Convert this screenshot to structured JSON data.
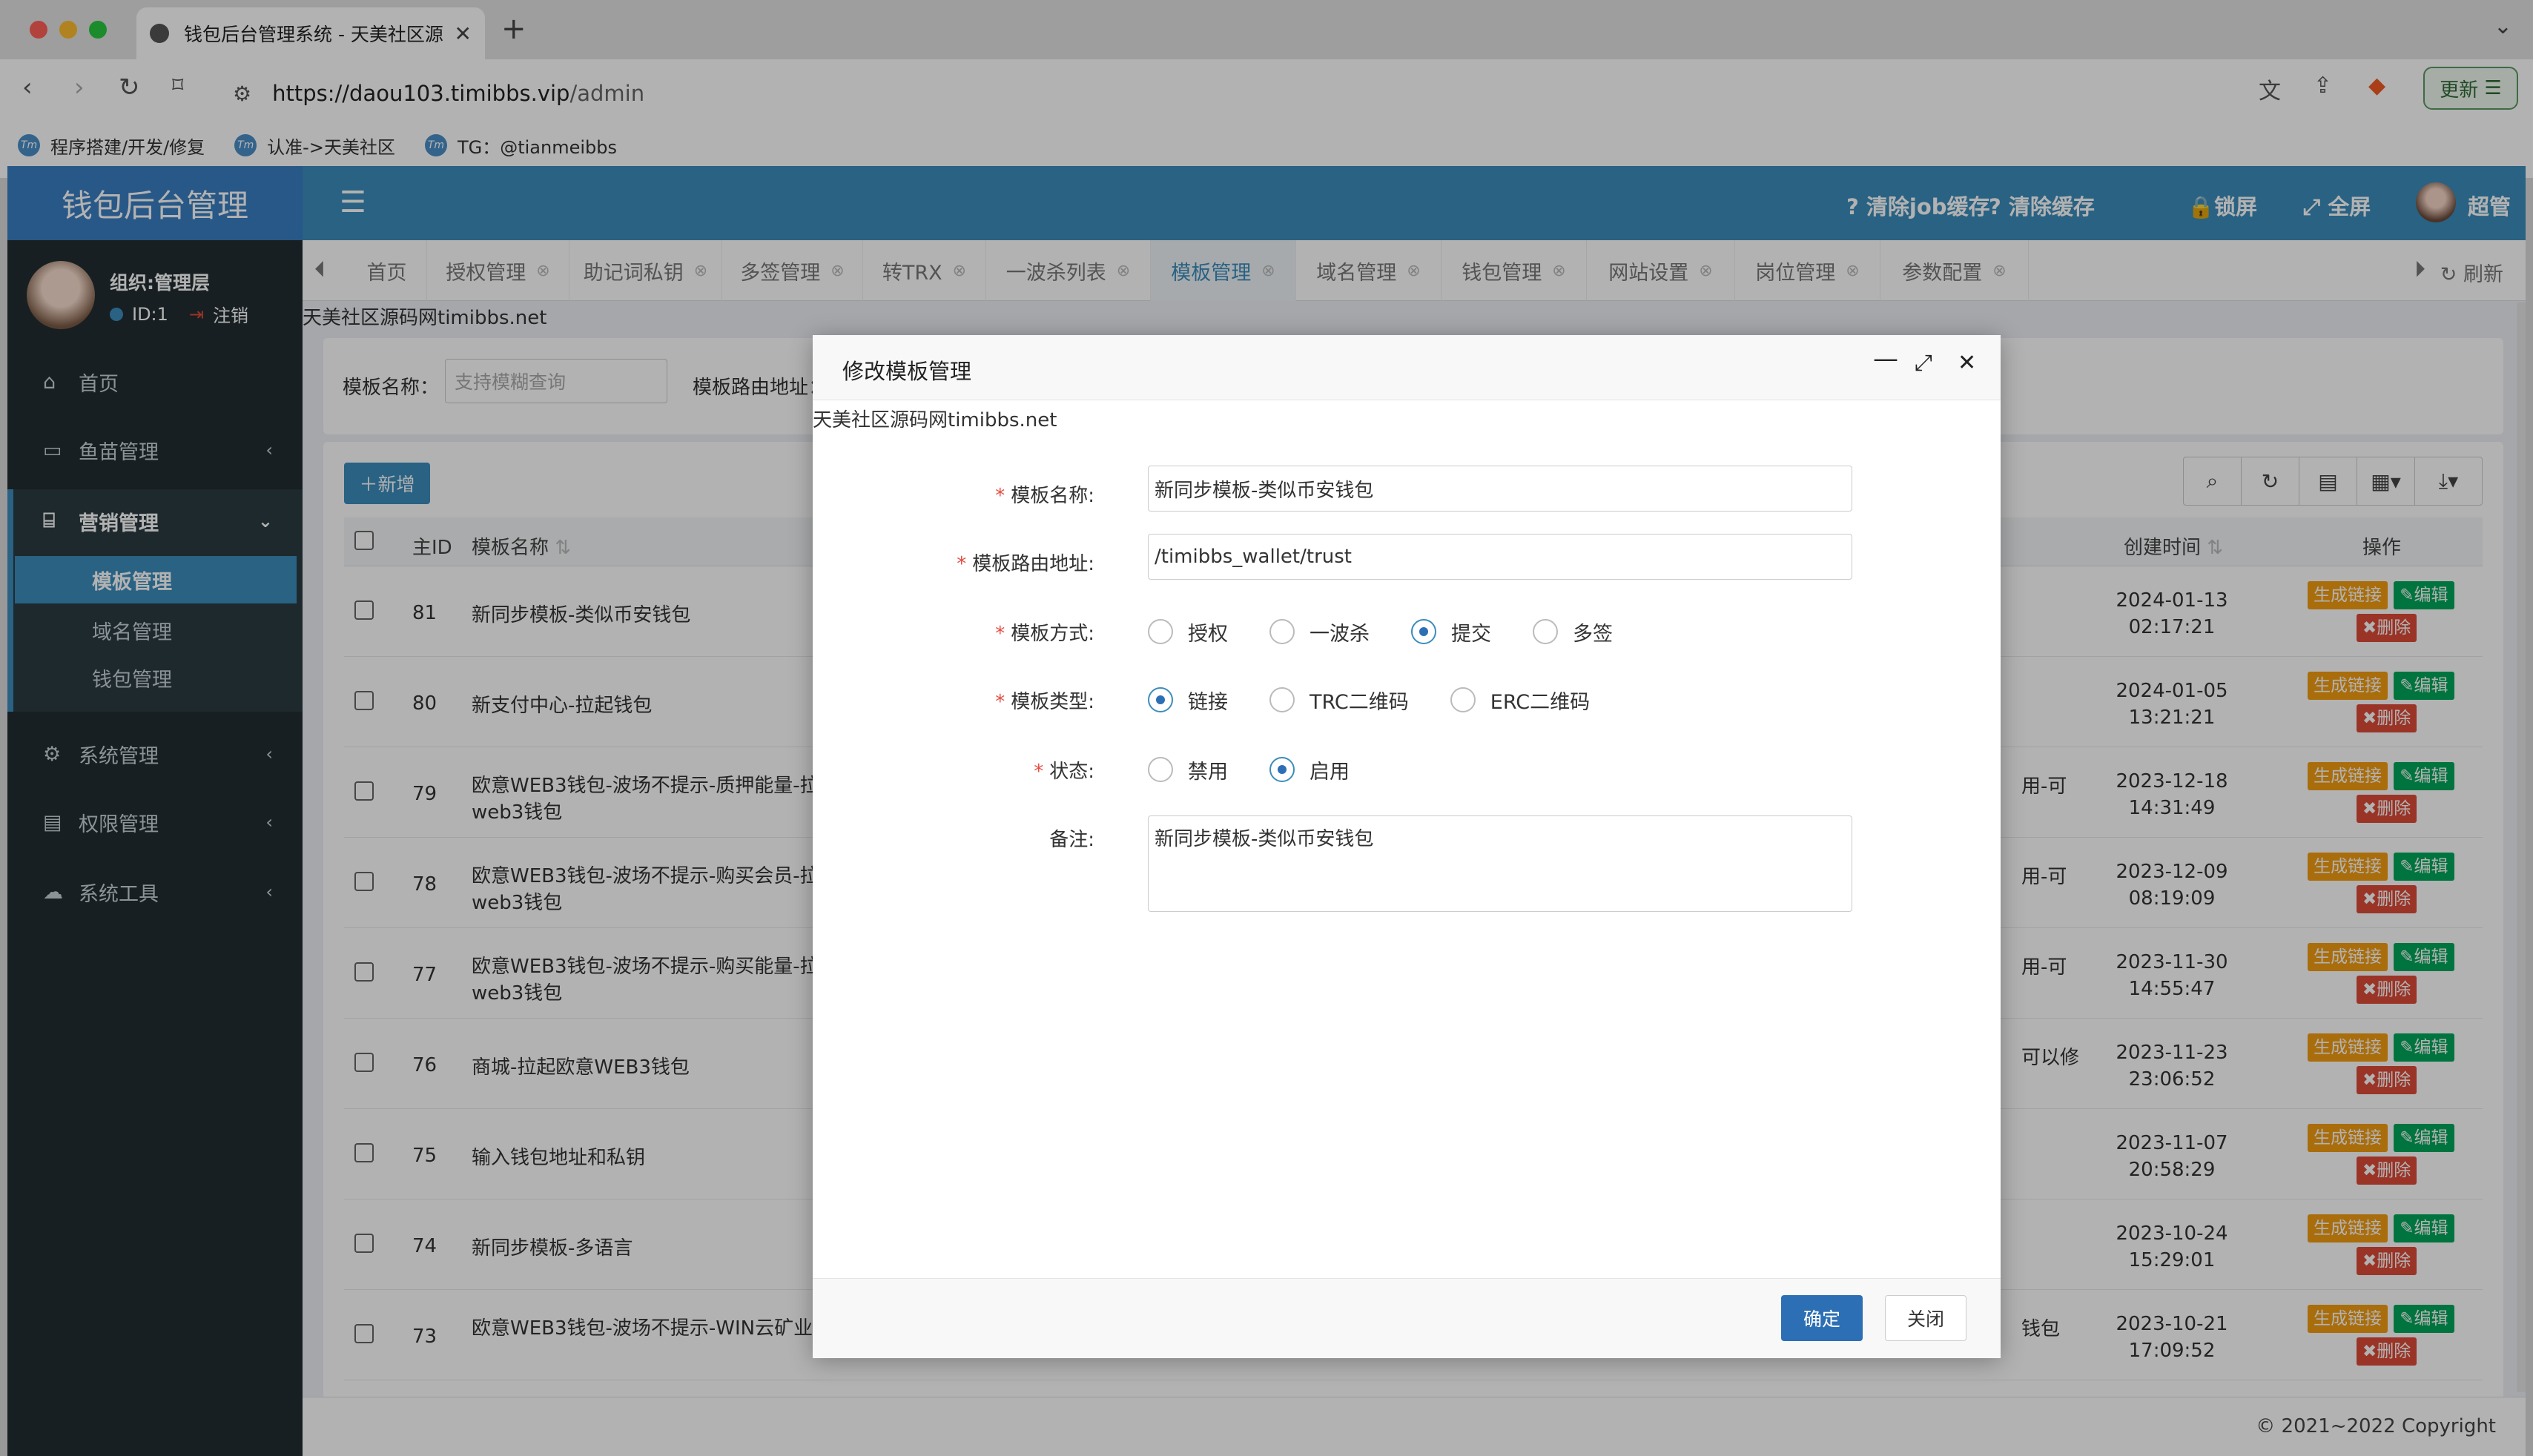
{
  "browser": {
    "tab_title": "钱包后台管理系统 - 天美社区源",
    "url_host": "https://daou103.timibbs.vip",
    "url_path": "/admin",
    "update_label": "更新",
    "bookmarks": [
      {
        "label": "程序搭建/开发/修复"
      },
      {
        "label": "认准->天美社区"
      },
      {
        "label": "TG：@tianmeibbs"
      }
    ],
    "colors": {
      "chrome_bg": "#e3e3e3"
    }
  },
  "app": {
    "logo_text": "钱包后台管理",
    "top_actions": [
      "清除job缓存",
      "清除缓存",
      "锁屏",
      "全屏"
    ],
    "user_name": "超管",
    "colors": {
      "primary": "#3c8dbc",
      "sidebar": "#222d32",
      "warning": "#f39c12",
      "success": "#00a65a",
      "danger": "#dd4b39"
    }
  },
  "sidebar": {
    "org": "组织:管理层",
    "id_text": "ID:1",
    "logout": "注销",
    "items": [
      {
        "label": "首页",
        "icon": "home-icon"
      },
      {
        "label": "鱼苗管理",
        "icon": "money-icon"
      },
      {
        "label": "营销管理",
        "icon": "bank-icon"
      },
      {
        "label": "系统管理",
        "icon": "gear-icon"
      },
      {
        "label": "权限管理",
        "icon": "id-card-icon"
      },
      {
        "label": "系统工具",
        "icon": "cloud-icon"
      }
    ],
    "sub_items": [
      "模板管理",
      "域名管理",
      "钱包管理"
    ]
  },
  "tabs": [
    "首页",
    "授权管理",
    "助记词私钥",
    "多签管理",
    "转TRX",
    "一波杀列表",
    "模板管理",
    "域名管理",
    "钱包管理",
    "网站设置",
    "岗位管理",
    "参数配置"
  ],
  "refresh_label": "刷新",
  "watermark": "天美社区源码网timibbs.net",
  "search": {
    "name_label": "模板名称：",
    "name_placeholder": "支持模糊查询",
    "route_label": "模板路由地址："
  },
  "table": {
    "add_label": "新增",
    "headers": {
      "id": "主ID",
      "name": "模板名称",
      "created": "创建时间",
      "ops": "操作"
    },
    "op_labels": {
      "gen": "生成链接",
      "edit": "编辑",
      "del": "删除"
    },
    "rows": [
      {
        "id": "81",
        "name": "新同步模板-类似币安钱包",
        "frag": "",
        "date": "2024-01-13",
        "time": "02:17:21"
      },
      {
        "id": "80",
        "name": "新支付中心-拉起钱包",
        "frag": "",
        "date": "2024-01-05",
        "time": "13:21:21"
      },
      {
        "id": "79",
        "name": "欧意WEB3钱包-波场不提示-质押能量-拉起web3钱包",
        "frag": "用-可",
        "date": "2023-12-18",
        "time": "14:31:49"
      },
      {
        "id": "78",
        "name": "欧意WEB3钱包-波场不提示-购买会员-拉起web3钱包",
        "frag": "用-可",
        "date": "2023-12-09",
        "time": "08:19:09"
      },
      {
        "id": "77",
        "name": "欧意WEB3钱包-波场不提示-购买能量-拉起web3钱包",
        "frag": "用-可",
        "date": "2023-11-30",
        "time": "14:55:47"
      },
      {
        "id": "76",
        "name": "商城-拉起欧意WEB3钱包",
        "frag": "可以修",
        "date": "2023-11-23",
        "time": "23:06:52"
      },
      {
        "id": "75",
        "name": "输入钱包地址和私钥",
        "frag": "",
        "date": "2023-11-07",
        "time": "20:58:29"
      },
      {
        "id": "74",
        "name": "新同步模板-多语言",
        "frag": "",
        "date": "2023-10-24",
        "time": "15:29:01"
      },
      {
        "id": "73",
        "name": "欧意WEB3钱包-波场不提示-WIN云矿业挖矿",
        "frag": "钱包",
        "date": "2023-10-21",
        "time": "17:09:52"
      }
    ]
  },
  "footer": {
    "copyright": "© 2021~2022 Copyright"
  },
  "modal": {
    "title": "修改模板管理",
    "watermark": "天美社区源码网timibbs.net",
    "fields": {
      "name_label": "模板名称:",
      "name_value": "新同步模板-类似币安钱包",
      "route_label": "模板路由地址:",
      "route_value": "/timibbs_wallet/trust",
      "mode_label": "模板方式:",
      "mode_options": [
        "授权",
        "一波杀",
        "提交",
        "多签"
      ],
      "mode_selected": "提交",
      "type_label": "模板类型:",
      "type_options": [
        "链接",
        "TRC二维码",
        "ERC二维码"
      ],
      "type_selected": "链接",
      "status_label": "状态:",
      "status_options": [
        "禁用",
        "启用"
      ],
      "status_selected": "启用",
      "remark_label": "备注:",
      "remark_value": "新同步模板-类似币安钱包"
    },
    "ok_label": "确定",
    "close_label": "关闭"
  }
}
